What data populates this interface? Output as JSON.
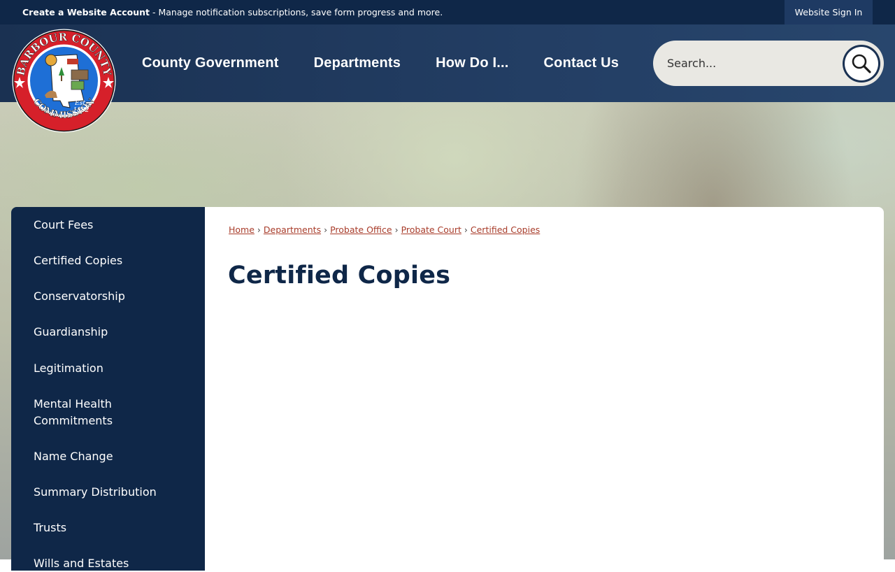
{
  "topbar": {
    "account_link": "Create a Website Account",
    "account_text": " - Manage notification subscriptions, save form progress and more.",
    "signin": "Website Sign In"
  },
  "logo": {
    "top_text": "BARBOUR COUNTY",
    "bottom_text": "COMMISSION",
    "est": "Est.",
    "year": "1832"
  },
  "nav": {
    "items": [
      "County Government",
      "Departments",
      "How Do I...",
      "Contact Us"
    ]
  },
  "search": {
    "placeholder": "Search...",
    "icon": "search-icon"
  },
  "sidebar": {
    "items": [
      "Court Fees",
      "Certified Copies",
      "Conservatorship",
      "Guardianship",
      "Legitimation",
      "Mental Health Commitments",
      "Name Change",
      "Summary Distribution",
      "Trusts",
      "Wills and Estates"
    ]
  },
  "breadcrumb": {
    "items": [
      "Home",
      "Departments",
      "Probate Office",
      "Probate Court",
      "Certified Copies"
    ],
    "separator": "›"
  },
  "page": {
    "title": "Certified Copies"
  },
  "colors": {
    "navy": "#0f2748",
    "header": "#233e64",
    "link": "#a83c2a",
    "seal_red": "#d6202a",
    "seal_blue": "#1e6fd6"
  }
}
